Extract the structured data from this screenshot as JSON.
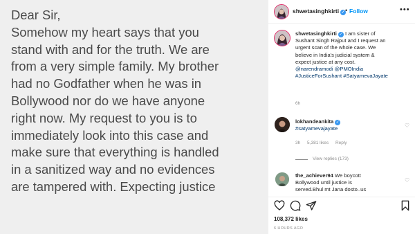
{
  "post_image": {
    "letter_lines": [
      "Dear Sir,",
      "Somehow my heart says that you",
      "stand with and for the truth. We are",
      "from a very simple family. My brother",
      "had no Godfather when he was in",
      "Bollywood nor do we have anyone",
      "right now. My request to you is to",
      "immediately look into this case and",
      "make sure that everything is handled",
      "in a sanitized way and no evidences",
      "are tampered with.  Expecting justice"
    ]
  },
  "header": {
    "username": "shwetasinghkirti",
    "separator": "•",
    "follow_label": "Follow",
    "more_icon": "more-icon"
  },
  "caption": {
    "username": "shwetasinghkirti",
    "lines": [
      "I am sister of",
      "Sushant Singh Rajput and I request an",
      "urgent scan of the whole case. We",
      "believe in India's judicial system &",
      "expect justice at any cost."
    ],
    "tags_line1": "@narendramodi @PMOIndia",
    "tags_line2": "#JusticeForSushant #SatyamevaJayate",
    "time": "6h"
  },
  "comments": [
    {
      "username": "lokhandeankita",
      "text": "#satyamevajayate",
      "time": "3h",
      "likes": "5,381 likes",
      "reply_label": "Reply",
      "view_replies": "View replies (173)"
    },
    {
      "username": "the_achiever94",
      "lines": [
        "We boycott",
        "Bollywood until justice is",
        "served.Bhul mt Jana dosto..us"
      ]
    }
  ],
  "actions": {
    "icons": [
      "heart-icon",
      "comment-icon",
      "share-icon",
      "bookmark-icon"
    ]
  },
  "likes": "108,372 likes",
  "post_time": "6 HOURS AGO"
}
